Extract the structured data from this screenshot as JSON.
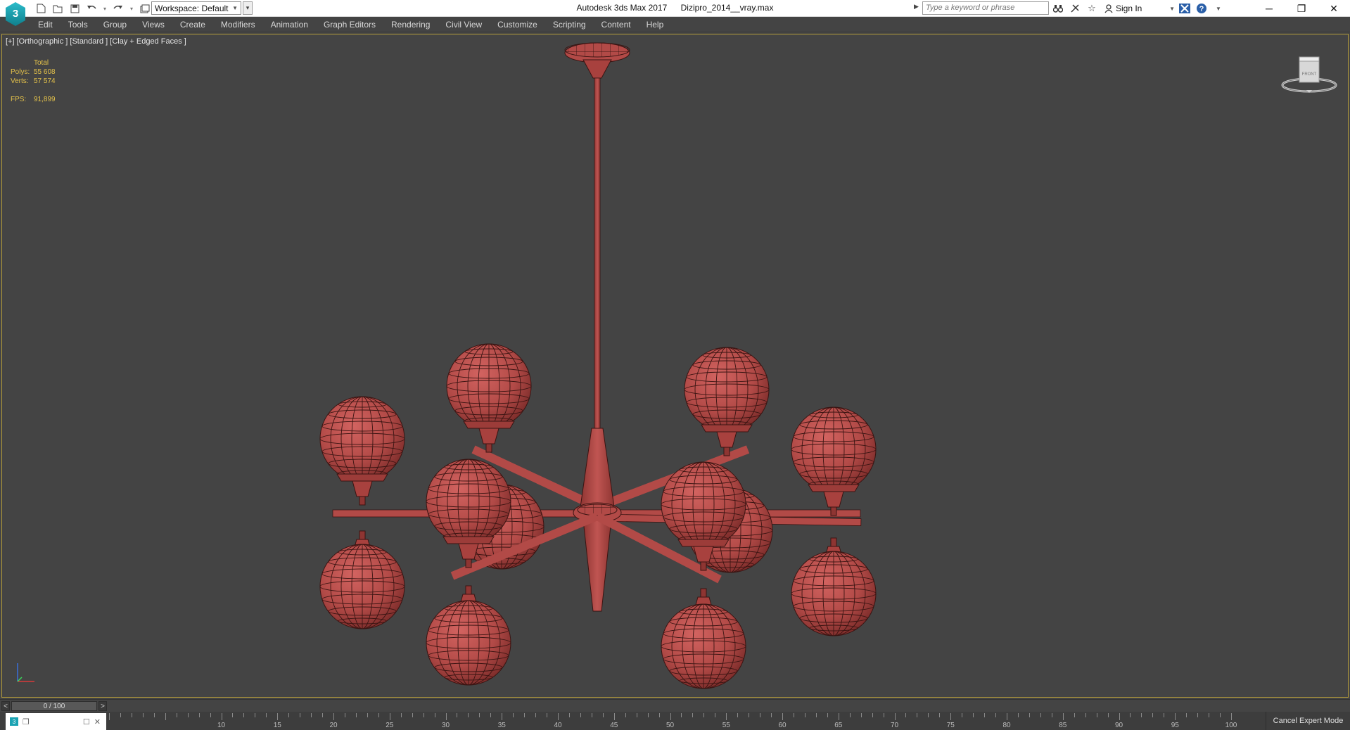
{
  "window": {
    "app_name": "Autodesk 3ds Max 2017",
    "file_name": "Dizipro_2014__vray.max",
    "minimize_label": "─",
    "restore_label": "❐",
    "close_label": "✕"
  },
  "quick_access": {
    "workspace_label": "Workspace: Default"
  },
  "help_bar": {
    "search_placeholder": "Type a keyword or phrase",
    "sign_in_label": "Sign In"
  },
  "menu": {
    "items": [
      "Edit",
      "Tools",
      "Group",
      "Views",
      "Create",
      "Modifiers",
      "Animation",
      "Graph Editors",
      "Rendering",
      "Civil View",
      "Customize",
      "Scripting",
      "Content",
      "Help"
    ]
  },
  "viewport": {
    "label": "[+] [Orthographic ] [Standard ] [Clay + Edged Faces ]",
    "stats": {
      "header": "Total",
      "polys_label": "Polys:",
      "polys_value": "55 608",
      "verts_label": "Verts:",
      "verts_value": "57 574",
      "fps_label": "FPS:",
      "fps_value": "91,899"
    },
    "viewcube_face": "FRONT",
    "object_color": "#b24a47"
  },
  "time_slider": {
    "position_label": "0 / 100",
    "prev_label": "<",
    "next_label": ">"
  },
  "trackbar": {
    "tick_labels": [
      "10",
      "15",
      "20",
      "25",
      "30",
      "35",
      "40",
      "45",
      "50",
      "55",
      "60",
      "65",
      "70",
      "75",
      "80",
      "85",
      "90",
      "95",
      "100"
    ],
    "cancel_expert_label": "Cancel Expert Mode"
  },
  "icons": [
    "app-logo-icon",
    "new-file-icon",
    "open-file-icon",
    "save-icon",
    "undo-icon",
    "redo-icon",
    "project-folder-icon",
    "binoculars-icon",
    "subscription-icon",
    "favorites-star-icon",
    "user-icon",
    "autodesk-x-icon",
    "help-icon",
    "viewcube-icon",
    "axis-tripod-icon"
  ]
}
